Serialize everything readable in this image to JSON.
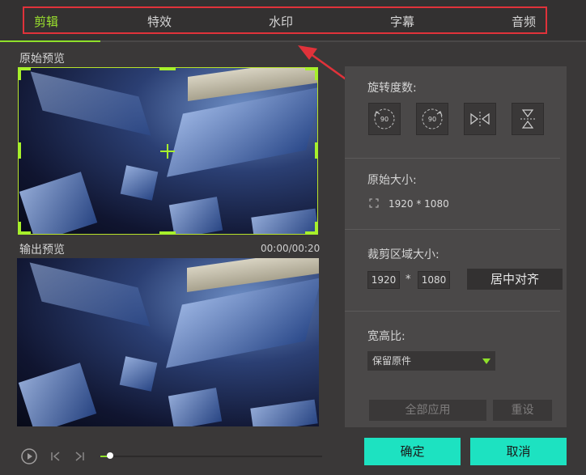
{
  "tabs": [
    {
      "label": "剪辑",
      "active": true
    },
    {
      "label": "特效",
      "active": false
    },
    {
      "label": "水印",
      "active": false
    },
    {
      "label": "字幕",
      "active": false
    },
    {
      "label": "音频",
      "active": false
    }
  ],
  "original_preview": {
    "label": "原始预览"
  },
  "output_preview": {
    "label": "输出预览",
    "time": "00:00/00:20"
  },
  "rotation": {
    "label": "旋转度数:",
    "buttons": [
      {
        "icon": "rotate-left-90-icon",
        "text": "90"
      },
      {
        "icon": "rotate-right-90-icon",
        "text": "90"
      },
      {
        "icon": "flip-horizontal-icon"
      },
      {
        "icon": "flip-vertical-icon"
      }
    ]
  },
  "original_size": {
    "label": "原始大小:",
    "value": "1920 * 1080"
  },
  "crop_size": {
    "label": "裁剪区域大小:",
    "width": "1920",
    "times": "*",
    "height": "1080",
    "center_button": "居中对齐"
  },
  "aspect_ratio": {
    "label": "宽高比:",
    "selected": "保留原件"
  },
  "actions": {
    "apply_all": "全部应用",
    "reset": "重设",
    "ok": "确定",
    "cancel": "取消"
  },
  "colors": {
    "accent_green": "#8ee02a",
    "primary_button": "#1de2c1",
    "annotation_red": "#e0323a"
  }
}
